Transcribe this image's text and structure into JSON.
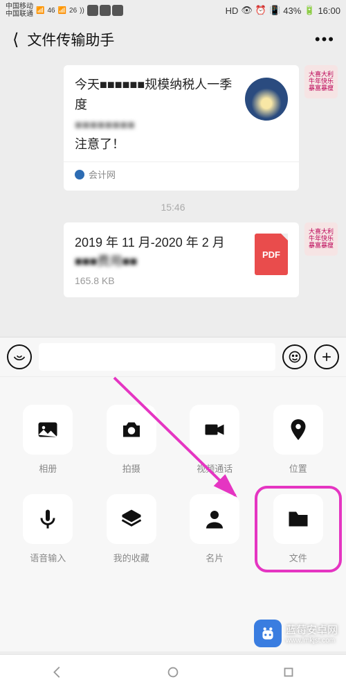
{
  "status": {
    "carrier1": "中国移动",
    "carrier2": "中国联通",
    "net1": "46",
    "net2": "26",
    "hd": "HD",
    "battery_pct": "43%",
    "time": "16:00"
  },
  "header": {
    "title": "文件传输助手"
  },
  "chat": {
    "msg1_line1": "今天■■■■■■规模纳税人一季度",
    "msg1_line2": "■■■■■■■■",
    "msg1_line3": "注意了！",
    "msg1_source": "会计网",
    "timestamp": "15:46",
    "file_name_line1": "2019 年 11 月-2020 年 2 月",
    "file_name_line2": "■■■费用■■",
    "file_size": "165.8 KB",
    "pdf_label": "PDF",
    "avatar_text": "大喜大利 牛年快乐 暴富暴瘦"
  },
  "panel": {
    "items": [
      {
        "label": "相册",
        "name": "gallery"
      },
      {
        "label": "拍摄",
        "name": "camera"
      },
      {
        "label": "视频通话",
        "name": "video-call"
      },
      {
        "label": "位置",
        "name": "location"
      },
      {
        "label": "语音输入",
        "name": "voice-input"
      },
      {
        "label": "我的收藏",
        "name": "favorites"
      },
      {
        "label": "名片",
        "name": "contact-card"
      },
      {
        "label": "文件",
        "name": "file"
      }
    ]
  },
  "watermark": {
    "title": "蓝莓安卓网",
    "url": "www.lmkjst.com"
  }
}
